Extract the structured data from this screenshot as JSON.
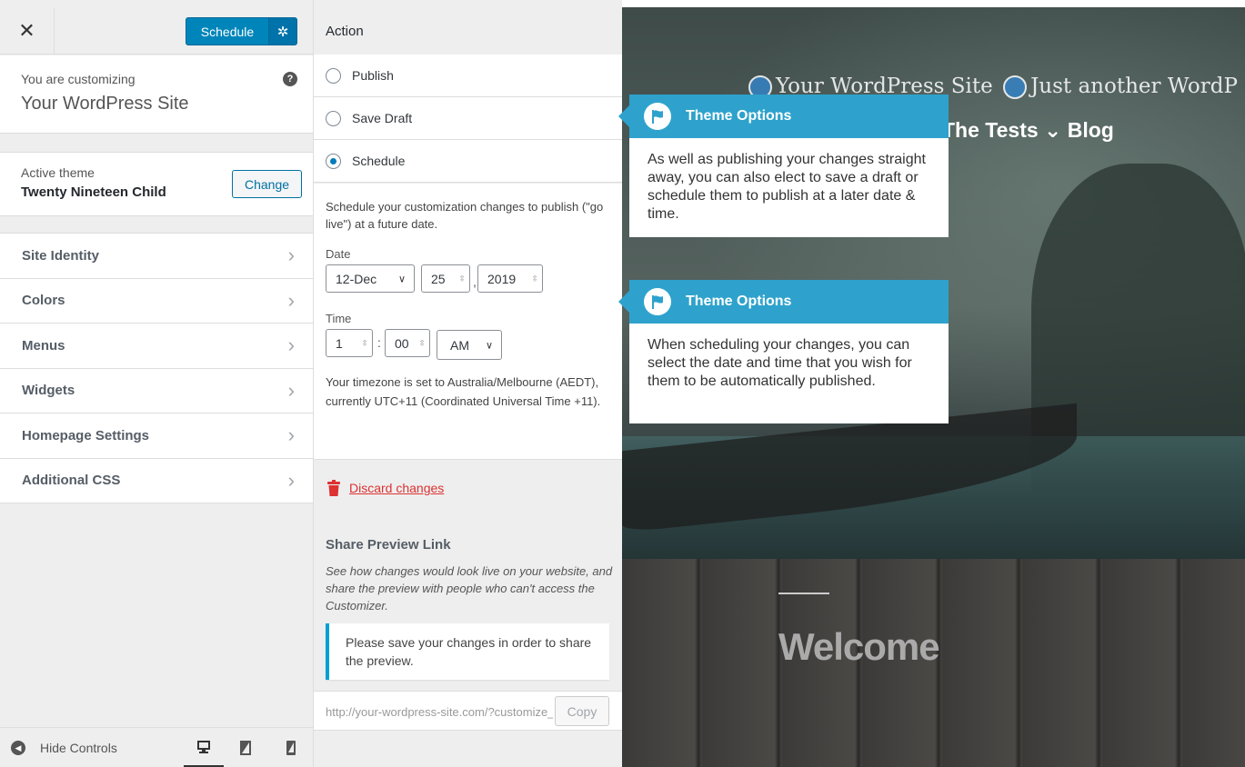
{
  "header": {
    "close_glyph": "✕",
    "schedule_label": "Schedule",
    "settings_glyph": "✲"
  },
  "customizing": {
    "label": "You are customizing",
    "site_name": "Your WordPress Site",
    "help_glyph": "?"
  },
  "active_theme": {
    "label": "Active theme",
    "name": "Twenty Nineteen Child",
    "change_label": "Change"
  },
  "sidebar": {
    "items": [
      {
        "label": "Site Identity"
      },
      {
        "label": "Colors"
      },
      {
        "label": "Menus"
      },
      {
        "label": "Widgets"
      },
      {
        "label": "Homepage Settings"
      },
      {
        "label": "Additional CSS"
      }
    ],
    "chevron": "›"
  },
  "footer": {
    "hide_controls_label": "Hide Controls",
    "hide_glyph": "◀"
  },
  "panel": {
    "heading": "Action",
    "options": {
      "publish": "Publish",
      "save_draft": "Save Draft",
      "schedule": "Schedule"
    },
    "selected": "schedule",
    "schedule_desc": "Schedule your customization changes to publish (\"go live\") at a future date.",
    "date_label": "Date",
    "date_month": "12-Dec",
    "date_day": "25",
    "date_year": "2019",
    "comma": ",",
    "time_label": "Time",
    "time_hour": "1",
    "time_colon": ":",
    "time_minute": "00",
    "time_meridiem": "AM",
    "caret": "∨",
    "spin": "⇳",
    "timezone_desc": "Your timezone is set to Australia/Melbourne (AEDT), currently UTC+11 (Coordinated Universal Time +11).",
    "discard_label": "Discard changes",
    "share_title": "Share Preview Link",
    "share_desc": "See how changes would look live on your website, and share the preview with people who can't access the Customizer.",
    "notice": "Please save your changes in order to share the preview.",
    "url_placeholder": "http://your-wordpress-site.com/?customize_changeset_uuid",
    "copy_label": "Copy"
  },
  "preview": {
    "site_title": "Your WordPress Site",
    "tagline": "Just another WordP",
    "nav_items": "The Tests ⌄  Blog",
    "welcome": "Welcome"
  },
  "callouts": [
    {
      "title": "Theme Options",
      "text": "As well as publishing your changes straight away, you can also elect to save a draft or schedule them to publish at a later date & time."
    },
    {
      "title": "Theme Options",
      "text": "When scheduling your changes, you can select the date and time that you wish for them to be automatically published."
    }
  ],
  "colors": {
    "primary_button": "#0085ba",
    "callout_header": "#2ea2cc",
    "discard_red": "#dc3232",
    "notice_border": "#00a0d2"
  }
}
